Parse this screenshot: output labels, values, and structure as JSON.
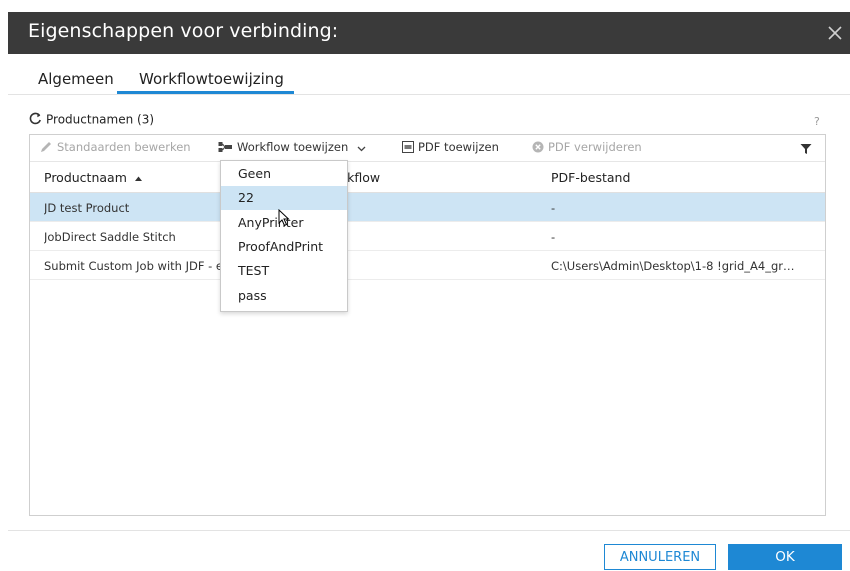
{
  "dialog": {
    "title": "Eigenschappen voor verbinding:"
  },
  "tabs": [
    {
      "label": "Algemeen"
    },
    {
      "label": "Workflowtoewijzing",
      "active": true
    }
  ],
  "section": {
    "title": "Productnamen (3)",
    "help": "?"
  },
  "toolbar": {
    "edit_defaults": "Standaarden bewerken",
    "assign_workflow": "Workflow toewijzen",
    "assign_pdf": "PDF toewijzen",
    "remove_pdf": "PDF verwijderen"
  },
  "table": {
    "headers": {
      "name": "Productnaam",
      "workflow": "rkflow",
      "pdf": "PDF-bestand"
    },
    "rows": [
      {
        "name": "JD test Product",
        "pdf": "-",
        "selected": true
      },
      {
        "name": "JobDirect Saddle Stitch",
        "pdf": "-"
      },
      {
        "name": "Submit Custom Job with JDF - e",
        "pdf": "C:\\Users\\Admin\\Desktop\\1-8 !grid_A4_gr…"
      }
    ]
  },
  "dropdown": {
    "options": [
      "Geen",
      "22",
      "AnyPrinter",
      "ProofAndPrint",
      "TEST",
      "pass"
    ],
    "hovered": "22"
  },
  "footer": {
    "cancel": "ANNULEREN",
    "ok": "OK"
  },
  "colors": {
    "accent": "#1e88d4",
    "titlebar": "#3a3a3a",
    "selection": "#cde4f4"
  }
}
